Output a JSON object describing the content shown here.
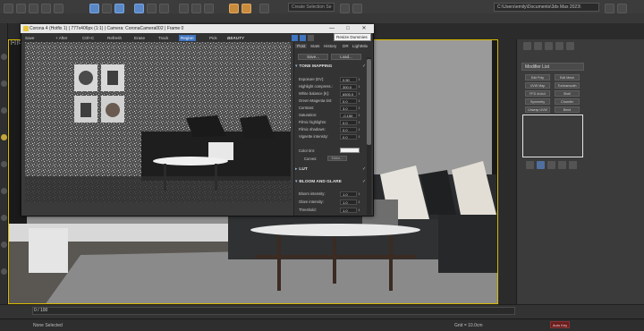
{
  "topbar": {
    "selection_set_placeholder": "Create Selection Se",
    "path": "C:\\Users\\emily\\Documents\\3ds Max 2023\\"
  },
  "viewport": {
    "label": "[+] [Ca",
    "colors": {
      "wall": "#8e8e8e",
      "floor": "#5a5652",
      "rug": "#8a8a8a",
      "sofa": "#2f3133",
      "pillow": "#e6e3dc",
      "table_top": "#e8e8e8",
      "table_leg": "#3b2b22",
      "border": "#d8b800"
    }
  },
  "vfb": {
    "title": "Corona 4 (Hotfix 1) | 777x406px (1:1) | Camera: CoronaCamera002 | Frame 0",
    "toolbar": {
      "save": "Save",
      "after": "+ After",
      "ctrlc": "Ctrl+C",
      "refresh": "Refresh",
      "erase": "Erase",
      "track": "Track",
      "region": "Region",
      "pick": "Pick",
      "pass": "BEAUTY"
    },
    "panel_tabs": [
      "Post",
      "Stats",
      "History",
      "DR",
      "LightMix"
    ],
    "save_btn": "Save...",
    "load_btn": "Load...",
    "sections": {
      "tone_mapping": "TONE MAPPING",
      "lut": "LUT",
      "bloom_glare": "BLOOM AND GLARE"
    },
    "tone_rows": [
      {
        "label": "Exposure (EV):",
        "value": "0.50"
      },
      {
        "label": "Highlight compress.:",
        "value": "300.0"
      },
      {
        "label": "White balance [K]:",
        "value": "6500.0"
      },
      {
        "label": "Green-Magenta tint:",
        "value": "0.0"
      },
      {
        "label": "Contrast:",
        "value": "3.0"
      },
      {
        "label": "Saturation:",
        "value": "-0.150"
      },
      {
        "label": "Filmic highlights:",
        "value": "0.0"
      },
      {
        "label": "Filmic shadows:",
        "value": "0.0"
      },
      {
        "label": "Vignette intensity:",
        "value": "0.0"
      }
    ],
    "color_tint_label": "Color tint:",
    "curves_label": "Curves:",
    "curves_btn": "Editor...",
    "bloom_rows": [
      {
        "label": "Bloom intensity:",
        "value": "1.0"
      },
      {
        "label": "Glare intensity:",
        "value": "1.0"
      },
      {
        "label": "Threshold:",
        "value": "1.0"
      }
    ]
  },
  "tooltip": "Resize Dummies",
  "window_controls": {
    "minimize": "—",
    "maximize": "□",
    "close": "✕"
  },
  "rightpanel": {
    "dropdown": "Modifier List",
    "buttons": [
      "Edit Poly",
      "Edit Mesh",
      "UVW Map",
      "Turbosmooth",
      "FFD 4x4x4",
      "Shell",
      "Symmetry",
      "Chamfer",
      "Unwrap UVW",
      "Bend"
    ]
  },
  "timeline": {
    "label": "0 / 100"
  },
  "status": {
    "text": "None Selected",
    "grid": "Grid = 10.0cm",
    "autokey": "Auto Key"
  }
}
